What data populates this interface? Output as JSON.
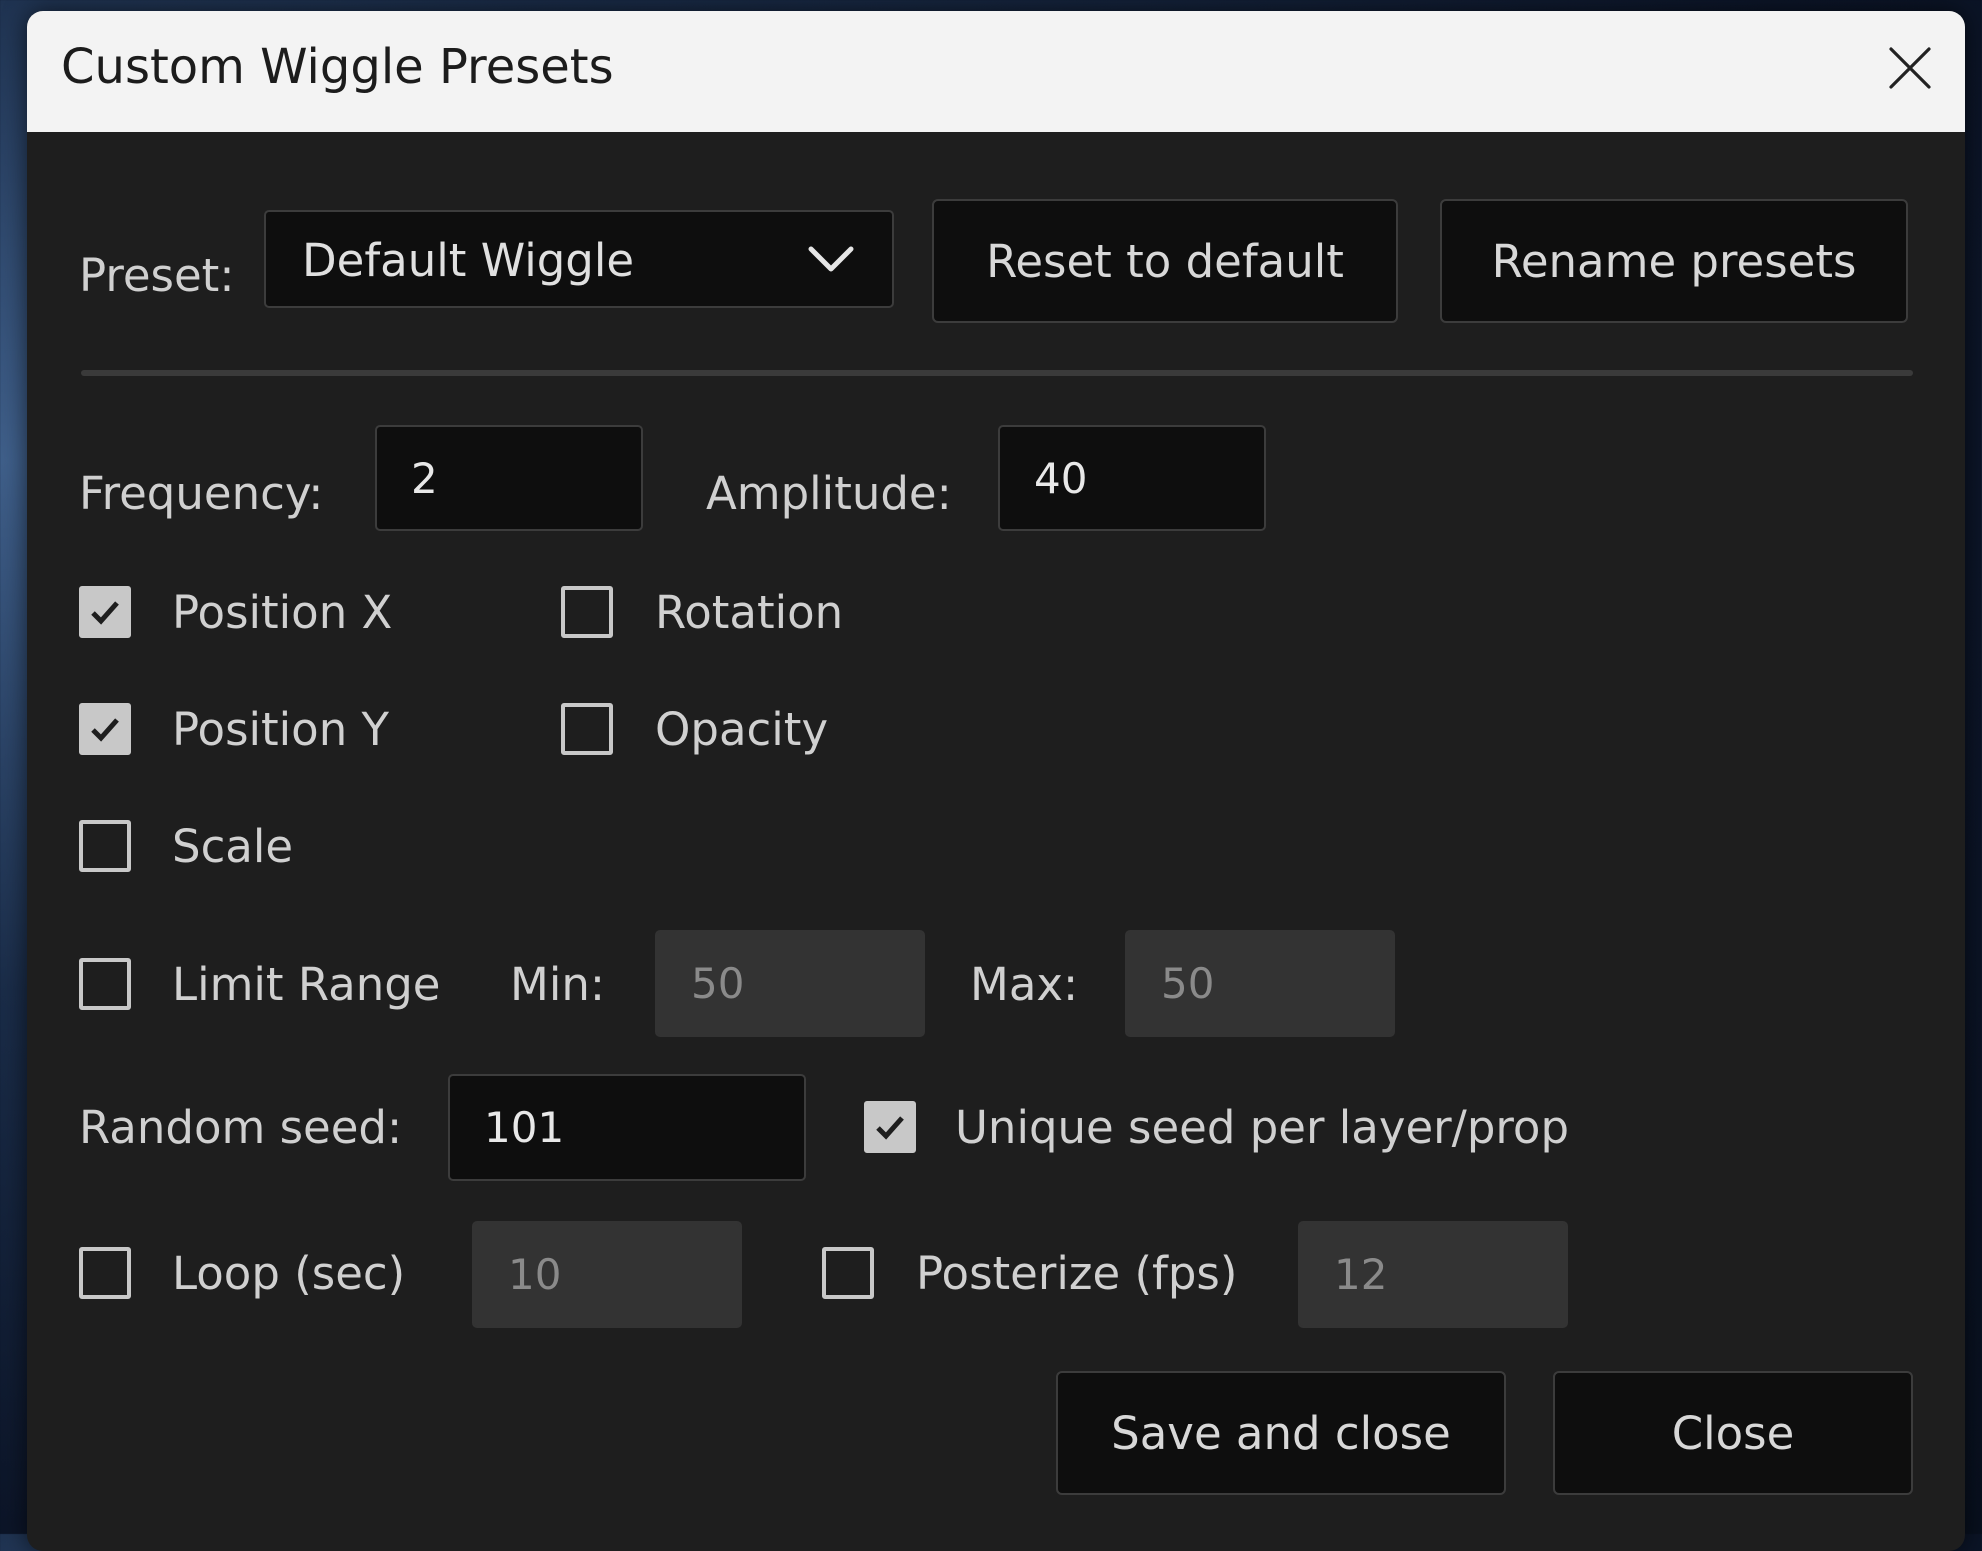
{
  "window": {
    "title": "Custom Wiggle Presets"
  },
  "preset": {
    "label": "Preset:",
    "selected": "Default Wiggle",
    "reset_label": "Reset to default",
    "rename_label": "Rename presets"
  },
  "frequency": {
    "label": "Frequency:",
    "value": "2"
  },
  "amplitude": {
    "label": "Amplitude:",
    "value": "40"
  },
  "properties": {
    "position_x": {
      "label": "Position X",
      "checked": true
    },
    "position_y": {
      "label": "Position Y",
      "checked": true
    },
    "scale": {
      "label": "Scale",
      "checked": false
    },
    "rotation": {
      "label": "Rotation",
      "checked": false
    },
    "opacity": {
      "label": "Opacity",
      "checked": false
    }
  },
  "limit_range": {
    "label": "Limit Range",
    "checked": false,
    "min_label": "Min:",
    "min_value": "50",
    "max_label": "Max:",
    "max_value": "50"
  },
  "seed": {
    "label": "Random seed:",
    "value": "101",
    "unique_label": "Unique seed per layer/prop",
    "unique_checked": true
  },
  "loop": {
    "label": "Loop (sec)",
    "checked": false,
    "value": "10"
  },
  "posterize": {
    "label": "Posterize (fps)",
    "checked": false,
    "value": "12"
  },
  "footer": {
    "save_label": "Save and close",
    "close_label": "Close"
  },
  "colors": {
    "dialog_bg": "#1e1e1e",
    "titlebar_bg": "#f3f3f3",
    "field_bg": "#0e0e0e",
    "disabled_field_bg": "#333333",
    "checkbox": "#c8c8c8"
  }
}
